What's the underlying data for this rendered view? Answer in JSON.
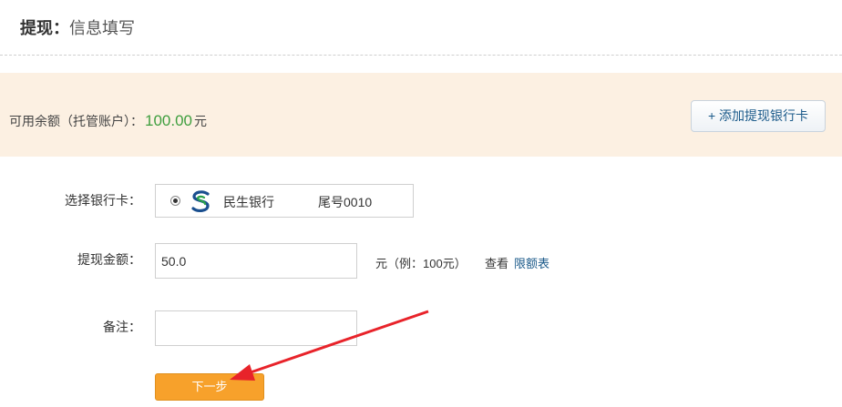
{
  "header": {
    "title_bold": "提现：",
    "title_rest": "信息填写"
  },
  "balance": {
    "label": "可用余额（托管账户）：",
    "amount": "100.00",
    "unit": "元"
  },
  "add_card_button": {
    "icon": "plus-icon",
    "plus": "+",
    "label": "添加提现银行卡"
  },
  "form": {
    "bank_label": "选择银行卡：",
    "bank": {
      "name": "民生银行",
      "tail": "尾号0010",
      "logo_icon": "minsheng-bank-logo",
      "selected": true
    },
    "amount_label": "提现金额：",
    "amount_value": "50.0",
    "amount_hint": "元（例：100元）",
    "view_text": "查看",
    "limit_link": "限额表",
    "remark_label": "备注：",
    "remark_value": ""
  },
  "next_button": {
    "label": "下一步"
  },
  "colors": {
    "balance_bg": "#fcf0e2",
    "amount_green": "#3e9e3e",
    "link_blue": "#1b5a8a",
    "next_orange": "#f7a12b",
    "annotation_arrow": "#e8232a"
  }
}
